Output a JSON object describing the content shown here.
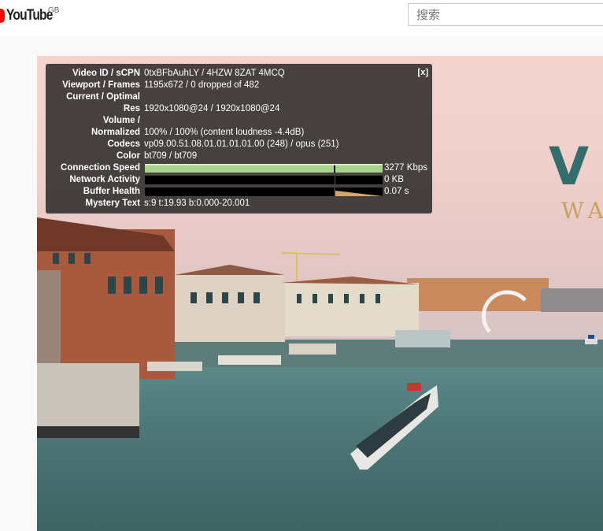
{
  "masthead": {
    "logo_text": "YouTube",
    "country_code": "GB",
    "search_placeholder": "搜索"
  },
  "video": {
    "overlay_title_letter": "V",
    "overlay_subtitle_fragment": "WA"
  },
  "stats_panel": {
    "close_label": "[x]",
    "rows": [
      {
        "label": "Video ID / sCPN",
        "value": "0txBFbAuhLY / 4HZW 8ZAT 4MCQ"
      },
      {
        "label": "Viewport / Frames",
        "value": "1195x672 / 0 dropped of 482"
      },
      {
        "label": "Current / Optimal",
        "value": ""
      },
      {
        "label": "Res",
        "value": "1920x1080@24 / 1920x1080@24"
      },
      {
        "label": "Volume /",
        "value": ""
      },
      {
        "label": "Normalized",
        "value": "100% / 100% (content loudness -4.4dB)"
      },
      {
        "label": "Codecs",
        "value": "vp09.00.51.08.01.01.01.01.00 (248) / opus (251)"
      },
      {
        "label": "Color",
        "value": "bt709 / bt709"
      },
      {
        "label": "Connection Speed",
        "value": "3277 Kbps",
        "graph": "connection"
      },
      {
        "label": "Network Activity",
        "value": "0 KB",
        "graph": "network"
      },
      {
        "label": "Buffer Health",
        "value": "0.07 s",
        "graph": "buffer"
      },
      {
        "label": "Mystery Text",
        "value": "s:9 t:19.93 b:0.000-20.001"
      }
    ]
  }
}
